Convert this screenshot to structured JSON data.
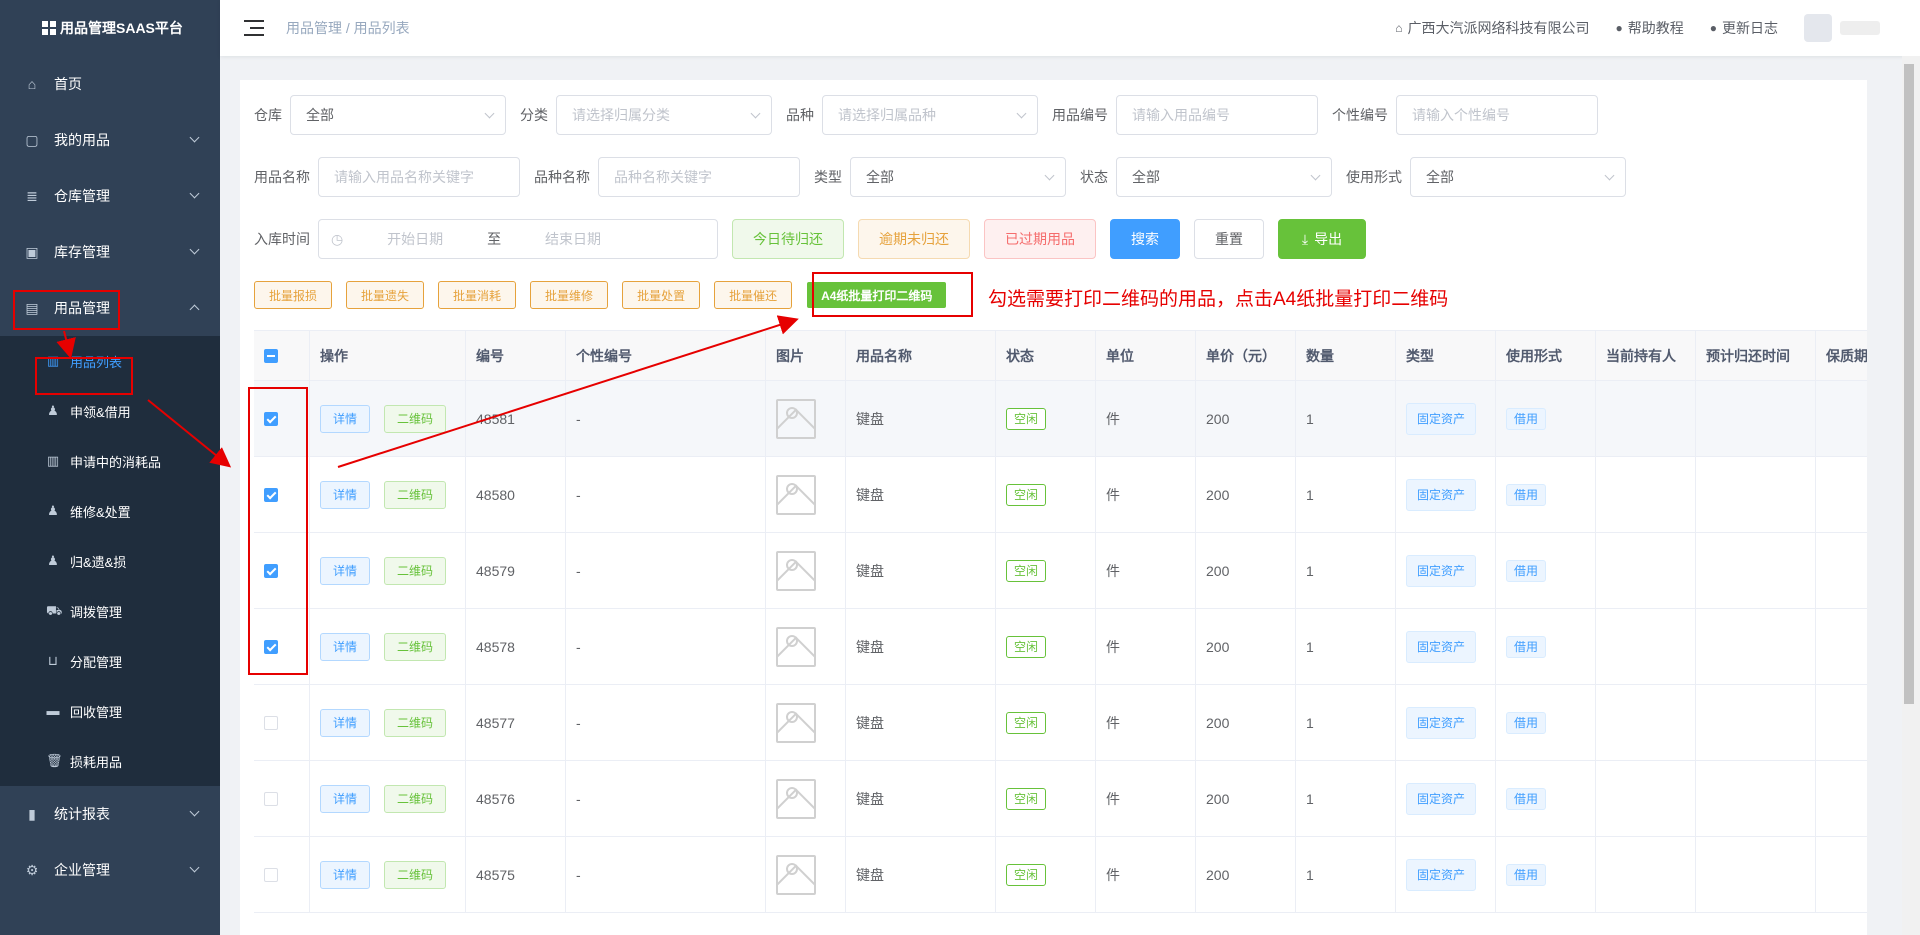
{
  "app": {
    "title": "用品管理SAAS平台"
  },
  "sidebar": {
    "items": [
      {
        "label": "首页",
        "icon": "home-icon"
      },
      {
        "label": "我的用品",
        "icon": "bag-icon"
      },
      {
        "label": "仓库管理",
        "icon": "database-icon"
      },
      {
        "label": "库存管理",
        "icon": "box-icon"
      },
      {
        "label": "用品管理",
        "icon": "inbox-icon"
      }
    ],
    "sub_items": [
      {
        "label": "用品列表",
        "icon": "clipboard-icon"
      },
      {
        "label": "申领&借用",
        "icon": "user-icon"
      },
      {
        "label": "申请中的消耗品",
        "icon": "clipboard-icon"
      },
      {
        "label": "维修&处置",
        "icon": "user-icon"
      },
      {
        "label": "归&遗&损",
        "icon": "user-icon"
      },
      {
        "label": "调拨管理",
        "icon": "truck-icon"
      },
      {
        "label": "分配管理",
        "icon": "cart-icon"
      },
      {
        "label": "回收管理",
        "icon": "recycle-icon"
      },
      {
        "label": "损耗用品",
        "icon": "trash-icon"
      }
    ],
    "bottom_items": [
      {
        "label": "统计报表",
        "icon": "bar-chart-icon"
      },
      {
        "label": "企业管理",
        "icon": "gear-icon"
      }
    ]
  },
  "header": {
    "breadcrumb_1": "用品管理",
    "breadcrumb_sep": "/",
    "breadcrumb_2": "用品列表",
    "company": "广西大汽派网络科技有限公司",
    "help": "帮助教程",
    "changelog": "更新日志"
  },
  "filters": {
    "warehouse_label": "仓库",
    "warehouse_value": "全部",
    "category_label": "分类",
    "category_ph": "请选择归属分类",
    "variety_label": "品种",
    "variety_ph": "请选择归属品种",
    "code_label": "用品编号",
    "code_ph": "请输入用品编号",
    "pcode_label": "个性编号",
    "pcode_ph": "请输入个性编号",
    "name_label": "用品名称",
    "name_ph": "请输入用品名称关键字",
    "vname_label": "品种名称",
    "vname_ph": "品种名称关键字",
    "type_label": "类型",
    "type_value": "全部",
    "status_label": "状态",
    "status_value": "全部",
    "usage_label": "使用形式",
    "usage_value": "全部",
    "date_label": "入库时间",
    "date_start_ph": "开始日期",
    "date_sep": "至",
    "date_end_ph": "结束日期"
  },
  "actions": {
    "today_return": "今日待归还",
    "overdue": "逾期未归还",
    "expired": "已过期用品",
    "search": "搜索",
    "reset": "重置",
    "export": "导出"
  },
  "batch": {
    "report_loss": "批量报损",
    "lost": "批量遗失",
    "consume": "批量消耗",
    "repair": "批量维修",
    "dispose": "批量处置",
    "remind": "批量催还",
    "print_qr": "A4纸批量打印二维码"
  },
  "annotation": "勾选需要打印二维码的用品，点击A4纸批量打印二维码",
  "table": {
    "headers": [
      "操作",
      "编号",
      "个性编号",
      "图片",
      "用品名称",
      "状态",
      "单位",
      "单价（元）",
      "数量",
      "类型",
      "使用形式",
      "当前持有人",
      "预计归还时间",
      "保质期截"
    ],
    "btn_detail": "详情",
    "btn_qr": "二维码",
    "rows": [
      {
        "checked": true,
        "code": "48581",
        "pcode": "-",
        "name": "键盘",
        "status": "空闲",
        "unit": "件",
        "price": "200",
        "qty": "1",
        "type": "固定资产",
        "usage": "借用"
      },
      {
        "checked": true,
        "code": "48580",
        "pcode": "-",
        "name": "键盘",
        "status": "空闲",
        "unit": "件",
        "price": "200",
        "qty": "1",
        "type": "固定资产",
        "usage": "借用"
      },
      {
        "checked": true,
        "code": "48579",
        "pcode": "-",
        "name": "键盘",
        "status": "空闲",
        "unit": "件",
        "price": "200",
        "qty": "1",
        "type": "固定资产",
        "usage": "借用"
      },
      {
        "checked": true,
        "code": "48578",
        "pcode": "-",
        "name": "键盘",
        "status": "空闲",
        "unit": "件",
        "price": "200",
        "qty": "1",
        "type": "固定资产",
        "usage": "借用"
      },
      {
        "checked": false,
        "code": "48577",
        "pcode": "-",
        "name": "键盘",
        "status": "空闲",
        "unit": "件",
        "price": "200",
        "qty": "1",
        "type": "固定资产",
        "usage": "借用"
      },
      {
        "checked": false,
        "code": "48576",
        "pcode": "-",
        "name": "键盘",
        "status": "空闲",
        "unit": "件",
        "price": "200",
        "qty": "1",
        "type": "固定资产",
        "usage": "借用"
      },
      {
        "checked": false,
        "code": "48575",
        "pcode": "-",
        "name": "键盘",
        "status": "空闲",
        "unit": "件",
        "price": "200",
        "qty": "1",
        "type": "固定资产",
        "usage": "借用"
      }
    ]
  },
  "colors": {
    "primary": "#409eff",
    "success": "#67c23a",
    "sidebar": "#304156",
    "annotation": "#e60000"
  }
}
